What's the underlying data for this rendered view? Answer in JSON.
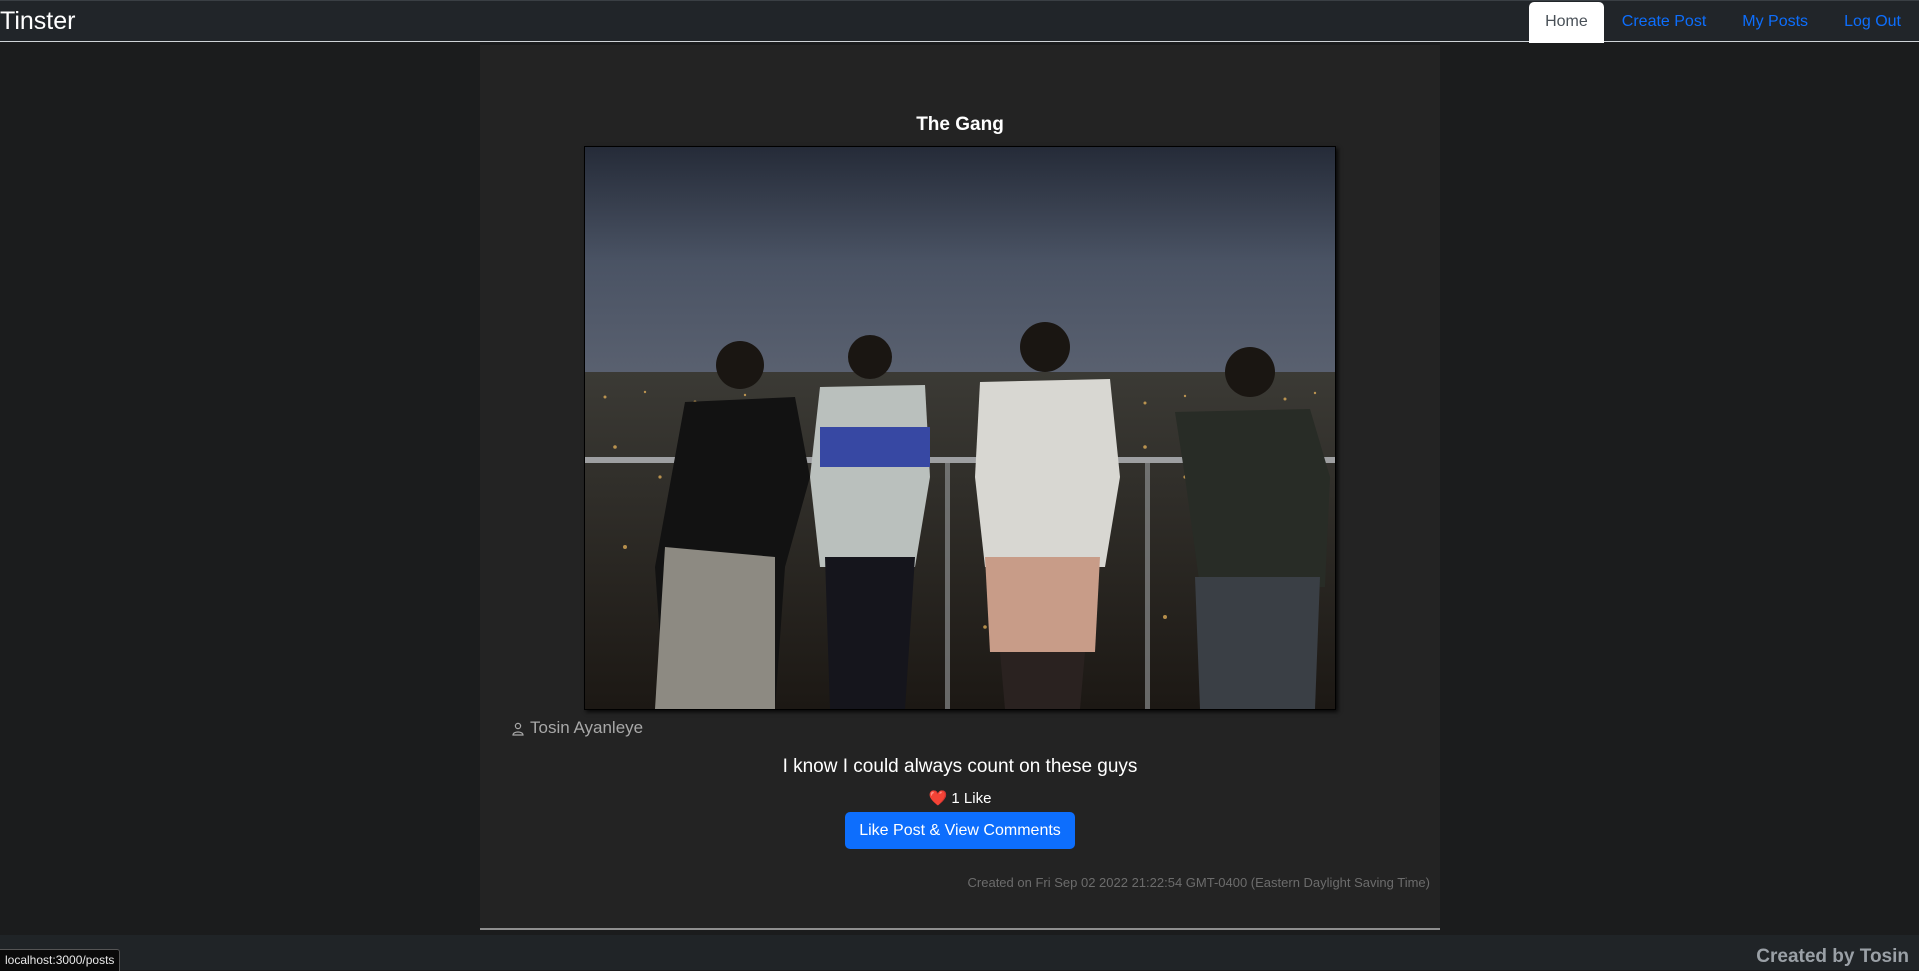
{
  "app": {
    "brand": "Tinster"
  },
  "nav": {
    "items": [
      {
        "label": "Home",
        "active": true
      },
      {
        "label": "Create Post",
        "active": false
      },
      {
        "label": "My Posts",
        "active": false
      },
      {
        "label": "Log Out",
        "active": false
      }
    ]
  },
  "post": {
    "title": "The Gang",
    "author": "Tosin Ayanleye",
    "caption": "I know I could always count on these guys",
    "likes_text": "❤️ 1 Like",
    "like_button": "Like Post & View Comments",
    "created": "Created on Fri Sep 02 2022 21:22:54 GMT-0400 (Eastern Daylight Saving Time)"
  },
  "footer": {
    "text": "Created by Tosin"
  },
  "status_bar": {
    "url": "localhost:3000/posts"
  },
  "colors": {
    "accent": "#0d6efd",
    "background": "#1b1c1d",
    "card": "#232323"
  },
  "icons": {
    "author": "user-icon"
  }
}
